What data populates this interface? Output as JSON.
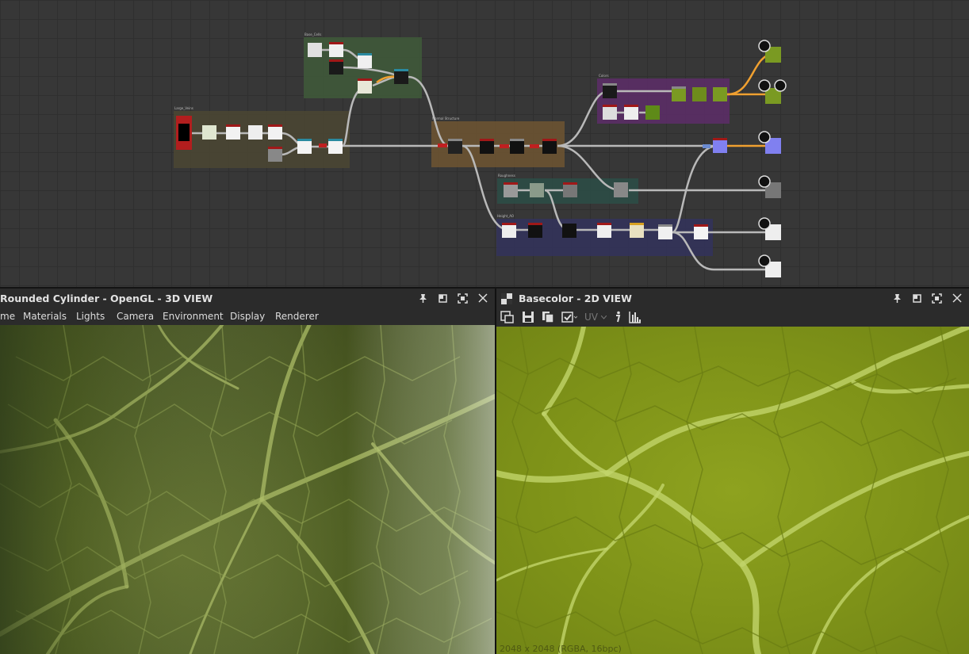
{
  "graph": {
    "frames": [
      {
        "id": "base_cells",
        "title": "Base_Cells",
        "color": "#3f5a3a"
      },
      {
        "id": "large_veins",
        "title": "Large_Veins",
        "color": "#4b4632"
      },
      {
        "id": "normal_structure",
        "title": "Normal Structure",
        "color": "#6b5332"
      },
      {
        "id": "colors",
        "title": "Colors",
        "color": "#5b2d66"
      },
      {
        "id": "roughness",
        "title": "Roughness",
        "color": "#2c4c46"
      },
      {
        "id": "height_ao",
        "title": "Height_AO",
        "color": "#33335a"
      }
    ]
  },
  "panel3d": {
    "title": "Rounded Cylinder - OpenGL - 3D VIEW",
    "menu": [
      "me",
      "Materials",
      "Lights",
      "Camera",
      "Environment",
      "Display",
      "Renderer"
    ]
  },
  "panel2d": {
    "title": "Basecolor - 2D VIEW",
    "uv_label": "UV",
    "status": "2048 x 2048 (RGBA, 16bpc)"
  },
  "icons": {
    "pin": "pin-icon",
    "restore": "restore-icon",
    "maximize": "maximize-icon",
    "close": "close-icon",
    "checker": "checker-icon",
    "export": "export-icon",
    "save": "save-icon",
    "copy": "copy-icon",
    "refresh": "refresh-icon",
    "info": "info-icon",
    "histogram": "histogram-icon",
    "output": "output-node-icon"
  },
  "colors": {
    "leaf_dark": "#4e5e23",
    "leaf_bright": "#8ea21f",
    "vein": "#b8cc5a",
    "wire": "#b9b9b9",
    "wire_orange": "#f0a030"
  }
}
